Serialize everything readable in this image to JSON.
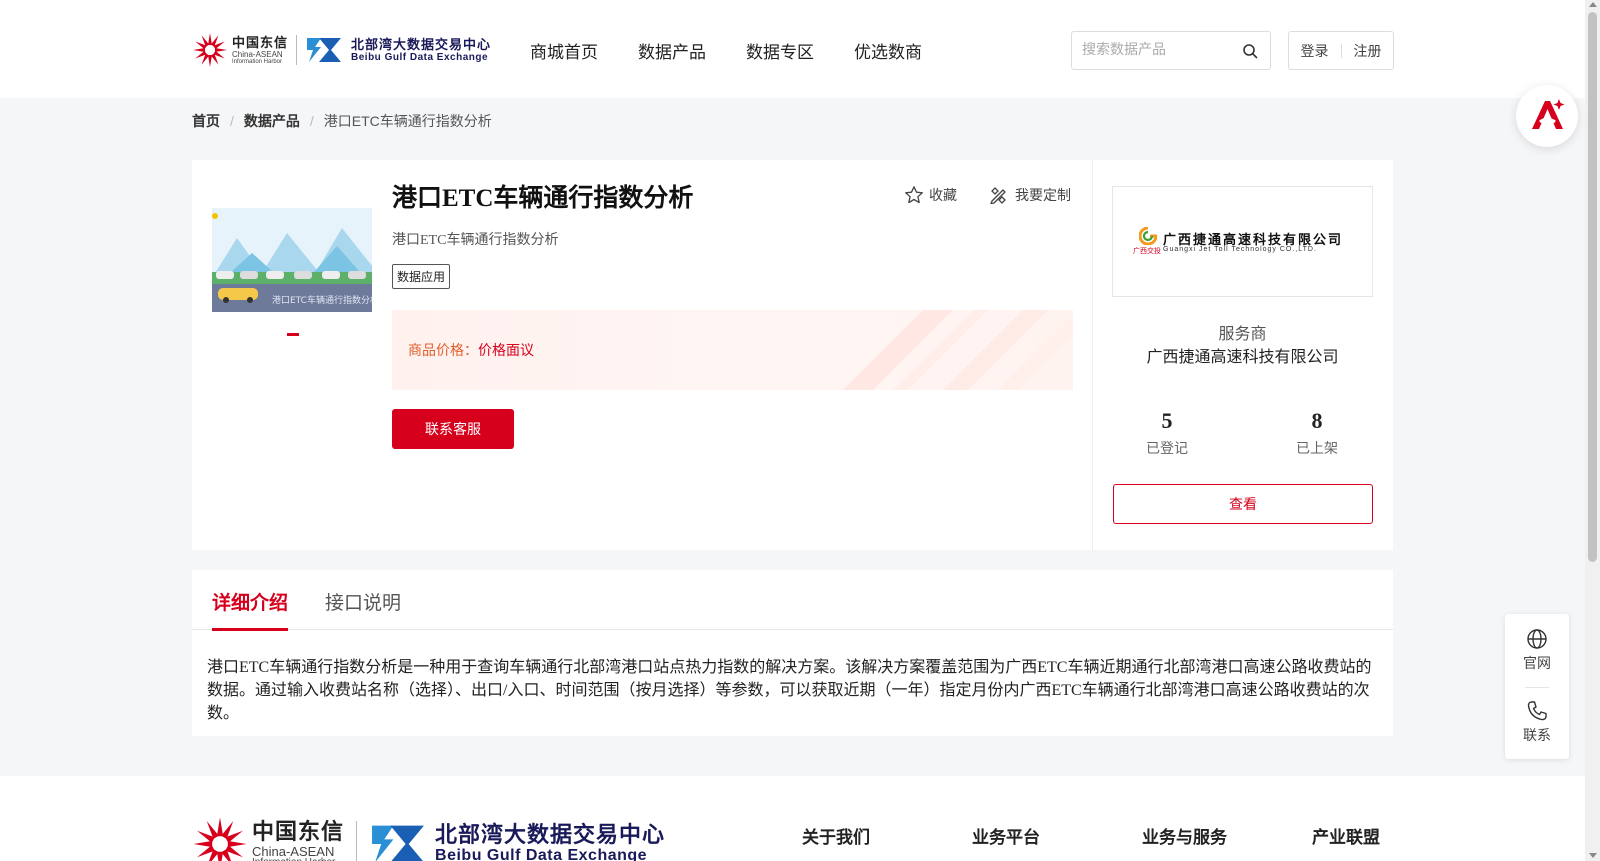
{
  "header": {
    "logo_primary": {
      "cn": "中国东信",
      "en": "China-ASEAN",
      "en_sub": "Information Harbor"
    },
    "logo_secondary": {
      "cn": "北部湾大数据交易中心",
      "en": "Beibu Gulf Data Exchange"
    },
    "nav": [
      "商城首页",
      "数据产品",
      "数据专区",
      "优选数商"
    ],
    "search_placeholder": "搜索数据产品",
    "login_label": "登录",
    "register_label": "注册"
  },
  "breadcrumb": {
    "home": "首页",
    "category": "数据产品",
    "current": "港口ETC车辆通行指数分析"
  },
  "product": {
    "title": "港口ETC车辆通行指数分析",
    "subtitle": "港口ETC车辆通行指数分析",
    "tag": "数据应用",
    "favorite_label": "收藏",
    "customize_label": "我要定制",
    "price_label": "商品价格：",
    "price_value": "价格面议",
    "contact_button": "联系客服",
    "thumbnail_text": "港口ETC车辆通行指数分析"
  },
  "vendor": {
    "logo_cn": "广西捷通高速科技有限公司",
    "logo_en": "Guangxi Jet Toll Technology CO.,LTD.",
    "logo_small": "广西交投",
    "label": "服务商",
    "name": "广西捷通高速科技有限公司",
    "registered_count": "5",
    "registered_label": "已登记",
    "listed_count": "8",
    "listed_label": "已上架",
    "view_button": "查看"
  },
  "details": {
    "tabs": [
      "详细介绍",
      "接口说明"
    ],
    "active_tab": "详细介绍",
    "description": "港口ETC车辆通行指数分析是一种用于查询车辆通行北部湾港口站点热力指数的解决方案。该解决方案覆盖范围为广西ETC车辆近期通行北部湾港口高速公路收费站的数据。通过输入收费站名称（选择）、出口/入口、时间范围（按月选择）等参数，可以获取近期（一年）指定月份内广西ETC车辆通行北部湾港口高速公路收费站的次数。"
  },
  "side_float": {
    "website_label": "官网",
    "contact_label": "联系"
  },
  "footer": {
    "nav": [
      "关于我们",
      "业务平台",
      "业务与服务",
      "产业联盟"
    ]
  },
  "colors": {
    "brand_red": "#d6001c",
    "price_orange": "#e2602d",
    "logo_navy": "#1a1a5a",
    "logo_blue": "#2b8fd6"
  }
}
